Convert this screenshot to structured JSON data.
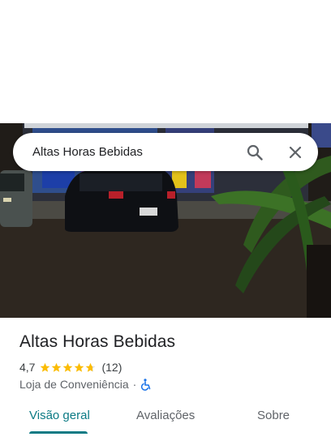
{
  "search": {
    "query": "Altas Horas Bebidas"
  },
  "place": {
    "name": "Altas Horas Bebidas",
    "rating": "4,7",
    "stars": 4.7,
    "review_count": "(12)",
    "category": "Loja de Conveniência",
    "separator": "·"
  },
  "tabs": [
    {
      "label": "Visão geral",
      "active": true
    },
    {
      "label": "Avaliações",
      "active": false
    },
    {
      "label": "Sobre",
      "active": false
    }
  ],
  "colors": {
    "accent": "#0b7a84",
    "star": "#fbbc04",
    "wheelchair": "#1a73e8"
  }
}
